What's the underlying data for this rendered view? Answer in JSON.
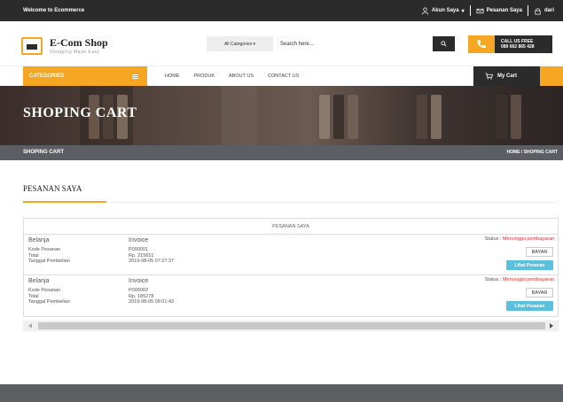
{
  "topbar": {
    "welcome": "Welcome to Ecommerce",
    "account": "Akun Saya",
    "orders": "Pesanan Saya",
    "user": "dari"
  },
  "header": {
    "logo_name": "E-Com Shop",
    "logo_tagline": "Shopping Made Easy",
    "category_select": "All Categories",
    "search_placeholder": "Search here...",
    "call_line1": "CALL US FREE",
    "call_line2": "089 662 865 428"
  },
  "nav": {
    "categories_label": "CATEGORIES",
    "menu": [
      "HOME",
      "PRODUK",
      "ABOUT US",
      "CONTACT US"
    ],
    "cart_label": "My Cart"
  },
  "banner": {
    "title": "SHOPING CART"
  },
  "breadcrumb": {
    "current": "SHOPING CART",
    "trail": "HOME  /  SHOPING CART"
  },
  "section": {
    "title": "PESANAN SAYA"
  },
  "table": {
    "header": "PESANAN SAYA",
    "rows": [
      {
        "heading_left": "Belanja",
        "heading_right": "Invoice",
        "labels": [
          "Kode Pesanan",
          "Total",
          "Tanggal Pembelian"
        ],
        "values": [
          "P000001",
          "Rp. 215651",
          "2019-08-05 07:27:37"
        ],
        "status_label": "Status : ",
        "status_value": "Menunggu pembayaran",
        "pay_label": "BAYAR",
        "view_label": "Lihat Pesanan"
      },
      {
        "heading_left": "Belanja",
        "heading_right": "Invoice",
        "labels": [
          "Kode Pesanan",
          "Total",
          "Tanggal Pembelian"
        ],
        "values": [
          "P000002",
          "Rp. 185278",
          "2019-08-05 08:01:43"
        ],
        "status_label": "Status : ",
        "status_value": "Menunggu pembayaran",
        "pay_label": "BAYAR",
        "view_label": "Lihat Pesanan"
      }
    ]
  },
  "colors": {
    "accent": "#f5a623",
    "dark": "#2b2b2b",
    "status": "#e03030",
    "info": "#5bc0de",
    "bar": "#5b5e63"
  }
}
